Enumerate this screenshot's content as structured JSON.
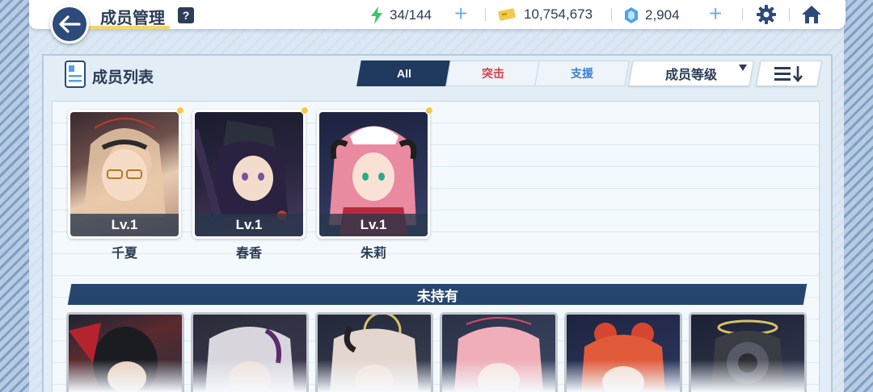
{
  "header": {
    "title": "成员管理",
    "help_label": "?",
    "ap": "34/144",
    "credits": "10,754,673",
    "gems": "2,904"
  },
  "panel": {
    "title": "成员列表",
    "tabs": [
      {
        "label": "All",
        "active": true,
        "color": "#ffffff"
      },
      {
        "label": "突击",
        "active": false,
        "color": "#d9414a"
      },
      {
        "label": "支援",
        "active": false,
        "color": "#3f7fcf"
      }
    ],
    "sort_label": "成员等级"
  },
  "owned": [
    {
      "name": "千夏",
      "level": "Lv.1"
    },
    {
      "name": "春香",
      "level": "Lv.1"
    },
    {
      "name": "朱莉",
      "level": "Lv.1"
    }
  ],
  "unowned_label": "未持有",
  "colors": {
    "accent_dark": "#1f3a5e",
    "plus_blue": "#6fb0e8",
    "ap_green": "#3fc56a",
    "credit_yellow": "#f2c94c",
    "gem_blue": "#4da3e8"
  }
}
